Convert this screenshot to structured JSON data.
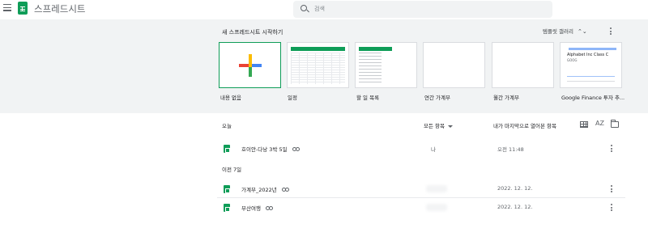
{
  "header": {
    "app_title": "스프레드시트",
    "search_placeholder": "검색"
  },
  "templates": {
    "section_title": "새 스프레드시트 시작하기",
    "gallery_label": "템플릿 갤러리",
    "gallery_toggle_icon": "unfold-icon",
    "items": [
      {
        "label": "내용 없음"
      },
      {
        "label": "일정"
      },
      {
        "label": "할 일 목록"
      },
      {
        "label": "연간 가계부"
      },
      {
        "label": "월간 가계부"
      },
      {
        "label": "Google Finance 투자 추...",
        "thumb_title": "Alphabet Inc Class C",
        "thumb_sub": "GOOG"
      }
    ]
  },
  "recent": {
    "today_heading": "오늘",
    "owner_filter": "모든 항목",
    "sort_label": "내가 마지막으로 열어본 항목",
    "sort_az_icon": "AZ",
    "files_today": [
      {
        "name": "호이안-다낭 3박 5일",
        "owner": "나",
        "date": "오전 11:48"
      }
    ],
    "earlier_heading": "이전 7일",
    "files_earlier": [
      {
        "name": "가계부_2022년",
        "owner": "",
        "date": "2022. 12. 12."
      },
      {
        "name": "부산여행",
        "owner": "",
        "date": "2022. 12. 12."
      }
    ]
  },
  "colors": {
    "sheets_green": "#0f9d58",
    "template_bg": "#f1f3f4",
    "plus_red": "#ea4335",
    "plus_blue": "#4285f4",
    "plus_yellow": "#fbbc04",
    "plus_green": "#34a853"
  }
}
